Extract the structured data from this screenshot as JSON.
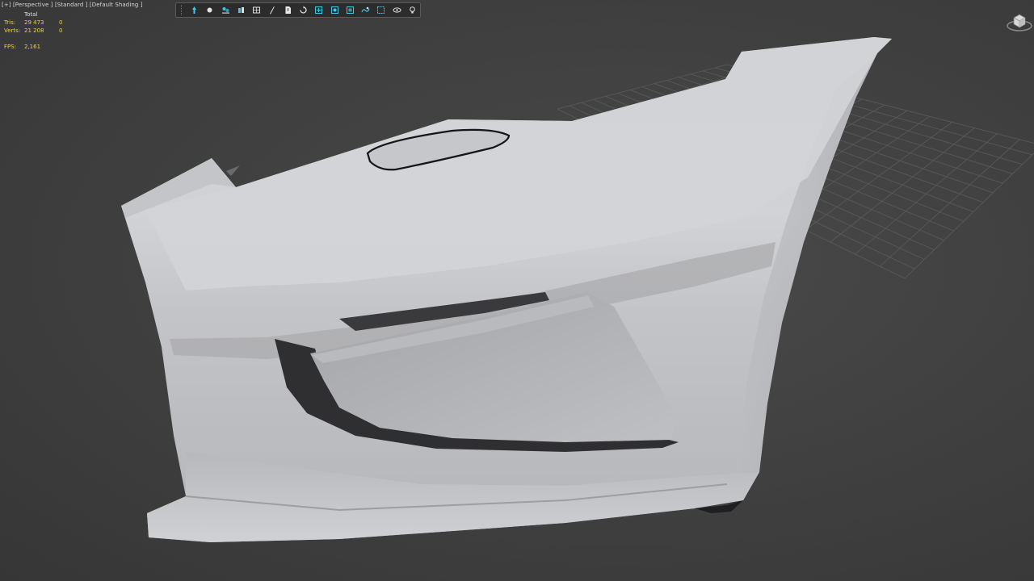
{
  "viewport": {
    "label_plus": "[+]",
    "label_view": "[Perspective ]",
    "label_mode": "[Standard ]",
    "label_shading": "[Default Shading ]"
  },
  "stats": {
    "header": "Total",
    "tris_label": "Tris:",
    "tris_total": "29 473",
    "tris_selected": "0",
    "verts_label": "Verts:",
    "verts_total": "21 208",
    "verts_selected": "0",
    "fps_label": "FPS:",
    "fps_value": "2,161"
  },
  "toolbar": {
    "icons": [
      "light-icon",
      "sphere-icon",
      "shadows-icon",
      "materials-icon",
      "grid-box-icon",
      "wand-icon",
      "page-icon",
      "refresh-icon",
      "safe-frame-icon",
      "region-icon",
      "zoom-region-icon",
      "ambient-icon",
      "frame-icon",
      "eye-icon",
      "bulb-icon"
    ],
    "icon_color": "#3fc6e8"
  },
  "colors": {
    "background": "#3e3e3e",
    "stats_text": "#e8d23a",
    "model_light": "#d4d5d8",
    "model_shadow": "#8e8f93"
  }
}
